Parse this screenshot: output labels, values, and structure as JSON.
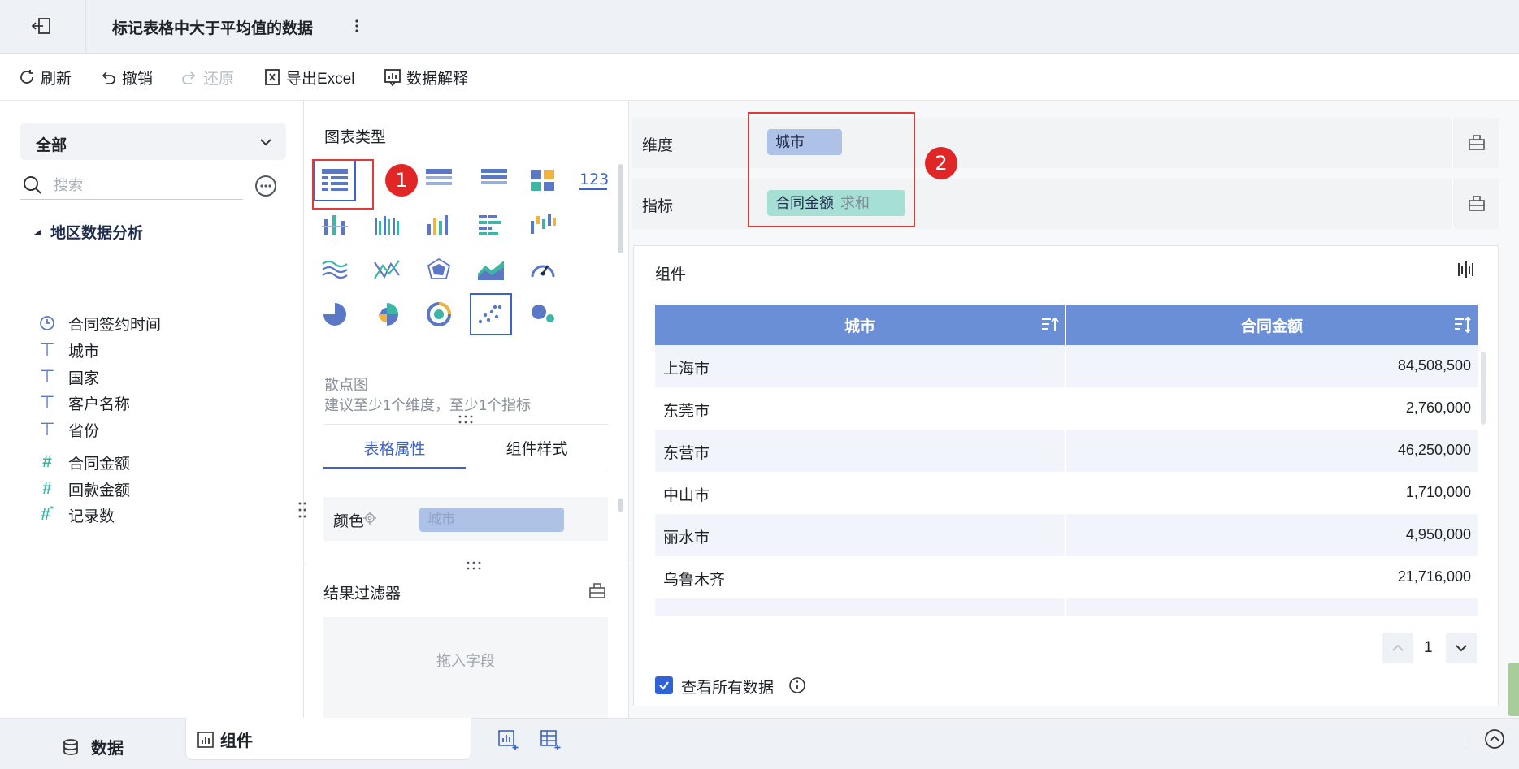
{
  "header": {
    "title": "标记表格中大于平均值的数据"
  },
  "toolbar": {
    "refresh": "刷新",
    "undo": "撤销",
    "redo": "还原",
    "export": "导出Excel",
    "explain": "数据解释"
  },
  "left": {
    "category": "全部",
    "search_placeholder": "搜索",
    "dataset": "地区数据分析",
    "fields": [
      {
        "name": "合同签约时间",
        "icon": "clock-icon"
      },
      {
        "name": "城市",
        "icon": "text-type-icon"
      },
      {
        "name": "国家",
        "icon": "text-type-icon"
      },
      {
        "name": "客户名称",
        "icon": "text-type-icon"
      },
      {
        "name": "省份",
        "icon": "text-type-icon"
      },
      {
        "name": "合同金额",
        "icon": "number-type-icon"
      },
      {
        "name": "回款金额",
        "icon": "number-type-icon"
      },
      {
        "name": "记录数",
        "icon": "number-type-icon"
      }
    ]
  },
  "middle": {
    "chart_type_label": "图表类型",
    "hover_name": "散点图",
    "hover_hint": "建议至少1个维度，至少1个指标",
    "tabs": [
      "表格属性",
      "组件样式"
    ],
    "color_label": "颜色",
    "color_field": "城市",
    "filter_label": "结果过滤器",
    "filter_drop": "拖入字段"
  },
  "annotations": {
    "badge1": "1",
    "badge2": "2"
  },
  "right": {
    "dimension_label": "维度",
    "dimension_field": "城市",
    "metric_label": "指标",
    "metric_field": "合同金额",
    "metric_agg": "求和",
    "component_label": "组件",
    "table": {
      "headers": [
        "城市",
        "合同金额"
      ],
      "rows": [
        [
          "上海市",
          "84,508,500"
        ],
        [
          "东莞市",
          "2,760,000"
        ],
        [
          "东营市",
          "46,250,000"
        ],
        [
          "中山市",
          "1,710,000"
        ],
        [
          "丽水市",
          "4,950,000"
        ],
        [
          "乌鲁木齐",
          "21,716,000"
        ],
        [
          "",
          ""
        ]
      ]
    },
    "page": "1",
    "view_all": "查看所有数据"
  },
  "bottom": {
    "data_tab": "数据",
    "component_tab": "组件"
  },
  "colors": {
    "accent": "#3c63c7",
    "header_bg": "#6b8fd6",
    "dim_pill": "#aec2e8",
    "metric_pill": "#a6e0d5",
    "highlight": "#e23a3a"
  }
}
